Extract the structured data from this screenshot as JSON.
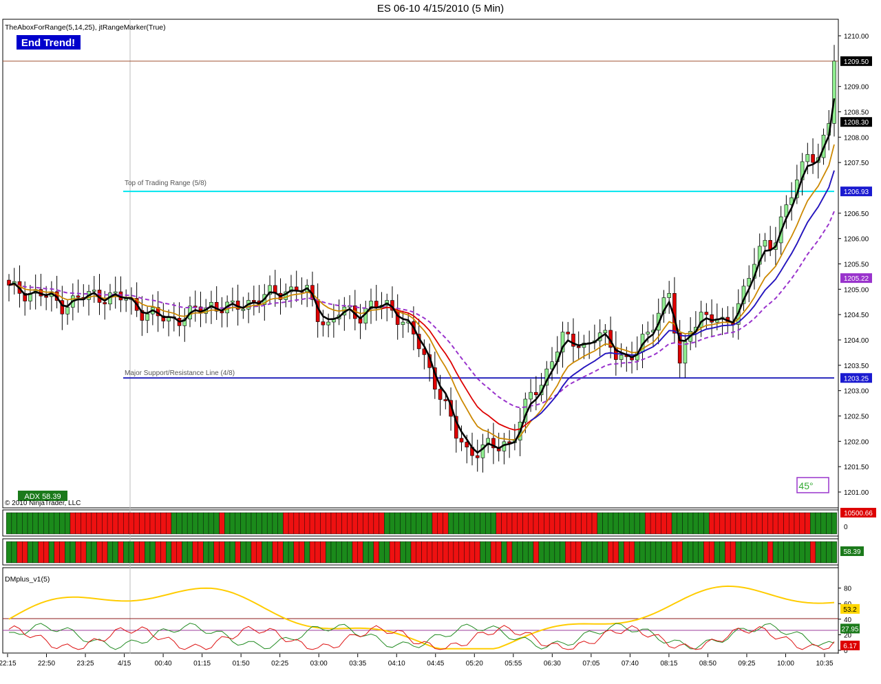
{
  "window": {
    "title": "ES 06-10  4/15/2010 (5 Min)"
  },
  "price_panel": {
    "indicator_label": "TheAboxForRange(5,14,25), jtRangeMarker(True)",
    "signal_badge": "End Trend!",
    "copyright": "© 2010 NinjaTrader, LLC",
    "adx_badge": "ADX 58.39",
    "angle_badge": "45°",
    "top_range_label": "Top of Trading Range (5/8)",
    "support_label": "Major Support/Resistance Line (4/8)",
    "y_ticks": [
      "1210.00",
      "1209.00",
      "1208.50",
      "1208.00",
      "1207.50",
      "1206.50",
      "1206.00",
      "1205.50",
      "1205.00",
      "1204.50",
      "1204.00",
      "1203.50",
      "1203.00",
      "1202.50",
      "1202.00",
      "1201.50",
      "1201.00"
    ],
    "price_tags": [
      {
        "text": "1209.50",
        "bg": "#000000",
        "fg": "#ffffff"
      },
      {
        "text": "1208.30",
        "bg": "#000000",
        "fg": "#ffffff"
      },
      {
        "text": "1206.93",
        "bg": "#1a1ad0",
        "fg": "#ffffff"
      },
      {
        "text": "1205.22",
        "bg": "#9933cc",
        "fg": "#ffffff"
      },
      {
        "text": "1203.25",
        "bg": "#1a1ad0",
        "fg": "#ffffff"
      }
    ],
    "colors": {
      "up": "#90ee90",
      "down": "#dd0000",
      "ema_fast": "#000000",
      "ema_mid": "#dd0000",
      "ema_slow": "#1a1acc",
      "dashed": "#9933cc",
      "orange": "#cc8800",
      "cyan": "#00e5ee",
      "support": "#2222bb",
      "range_top": "#a05030"
    }
  },
  "volume_panel": {
    "tag": "10500.66",
    "zero_tick": "0"
  },
  "trend_panel": {
    "tag": "58.39"
  },
  "dm_panel": {
    "label": "DMplus_v1(5)",
    "y_ticks": [
      "80",
      "60",
      "40",
      "20",
      "0"
    ],
    "tags": [
      {
        "text": "53.2",
        "bg": "#ffd700",
        "fg": "#000000"
      },
      {
        "text": "27.95",
        "bg": "#1b7a1b",
        "fg": "#ffffff"
      },
      {
        "text": "6.17",
        "bg": "#dd0000",
        "fg": "#ffffff"
      }
    ]
  },
  "x_axis": {
    "labels": [
      "22:15",
      "22:50",
      "23:25",
      "4/15",
      "00:40",
      "01:15",
      "01:50",
      "02:25",
      "03:00",
      "03:35",
      "04:10",
      "04:45",
      "05:20",
      "05:55",
      "06:30",
      "07:05",
      "07:40",
      "08:15",
      "08:50",
      "09:25",
      "10:00",
      "10:35"
    ]
  },
  "chart_data": {
    "type": "candlestick",
    "title": "ES 06-10  4/15/2010 (5 Min)",
    "timeframe": "5 Min",
    "ylim": [
      1200.9,
      1210.3
    ],
    "close_anchors": [
      [
        0,
        1205.0
      ],
      [
        6,
        1204.9
      ],
      [
        10,
        1204.7
      ],
      [
        16,
        1204.9
      ],
      [
        22,
        1204.8
      ],
      [
        26,
        1204.5
      ],
      [
        30,
        1204.4
      ],
      [
        34,
        1204.5
      ],
      [
        38,
        1204.7
      ],
      [
        42,
        1204.6
      ],
      [
        46,
        1204.8
      ],
      [
        50,
        1204.9
      ],
      [
        54,
        1205.05
      ],
      [
        56,
        1204.9
      ],
      [
        58,
        1204.5
      ],
      [
        60,
        1204.3
      ],
      [
        62,
        1204.55
      ],
      [
        66,
        1204.5
      ],
      [
        68,
        1204.7
      ],
      [
        72,
        1204.6
      ],
      [
        74,
        1204.4
      ],
      [
        76,
        1204.1
      ],
      [
        78,
        1203.6
      ],
      [
        80,
        1203.2
      ],
      [
        82,
        1202.7
      ],
      [
        84,
        1202.1
      ],
      [
        86,
        1201.8
      ],
      [
        88,
        1201.85
      ],
      [
        90,
        1201.9
      ],
      [
        92,
        1201.85
      ],
      [
        94,
        1202.0
      ],
      [
        96,
        1202.4
      ],
      [
        98,
        1202.9
      ],
      [
        100,
        1203.1
      ],
      [
        102,
        1203.7
      ],
      [
        104,
        1204.0
      ],
      [
        108,
        1203.9
      ],
      [
        110,
        1204.1
      ],
      [
        112,
        1204.0
      ],
      [
        114,
        1203.75
      ],
      [
        116,
        1203.65
      ],
      [
        118,
        1203.75
      ],
      [
        120,
        1204.1
      ],
      [
        122,
        1204.6
      ],
      [
        124,
        1204.95
      ],
      [
        126,
        1203.4
      ],
      [
        128,
        1204.3
      ],
      [
        130,
        1204.5
      ],
      [
        132,
        1204.4
      ],
      [
        134,
        1204.3
      ],
      [
        136,
        1204.5
      ],
      [
        138,
        1204.95
      ],
      [
        140,
        1205.5
      ],
      [
        142,
        1205.95
      ],
      [
        144,
        1206.0
      ],
      [
        146,
        1206.6
      ],
      [
        148,
        1207.1
      ],
      [
        150,
        1207.8
      ],
      [
        152,
        1207.5
      ],
      [
        154,
        1208.3
      ],
      [
        155,
        1209.5
      ]
    ],
    "series": [
      {
        "name": "",
        "values_note": "5 close"
      },
      {
        "name": "",
        "values_note": "14 period"
      },
      {
        "name": "",
        "values_note": "25 period"
      }
    ],
    "levels": [
      {
        "name": "Top of Trading Range (5/8)",
        "value": 1206.93
      },
      {
        "name": "Major Support/Resistance Line (4/8)",
        "value": 1203.25
      },
      {
        "name": "",
        "value": 1209.5
      }
    ],
    "last_values": {
      "price": 1209.5,
      "ema": 1208.3,
      "blue": 1206.93,
      "purple": 1205.22
    },
    "adx": 58.39,
    "volume_last": 10500.66,
    "dm_plus": {
      "last": 53.2,
      "mid_last": 27.95,
      "low_last": 6.17,
      "levels": [
        40,
        25
      ]
    }
  }
}
